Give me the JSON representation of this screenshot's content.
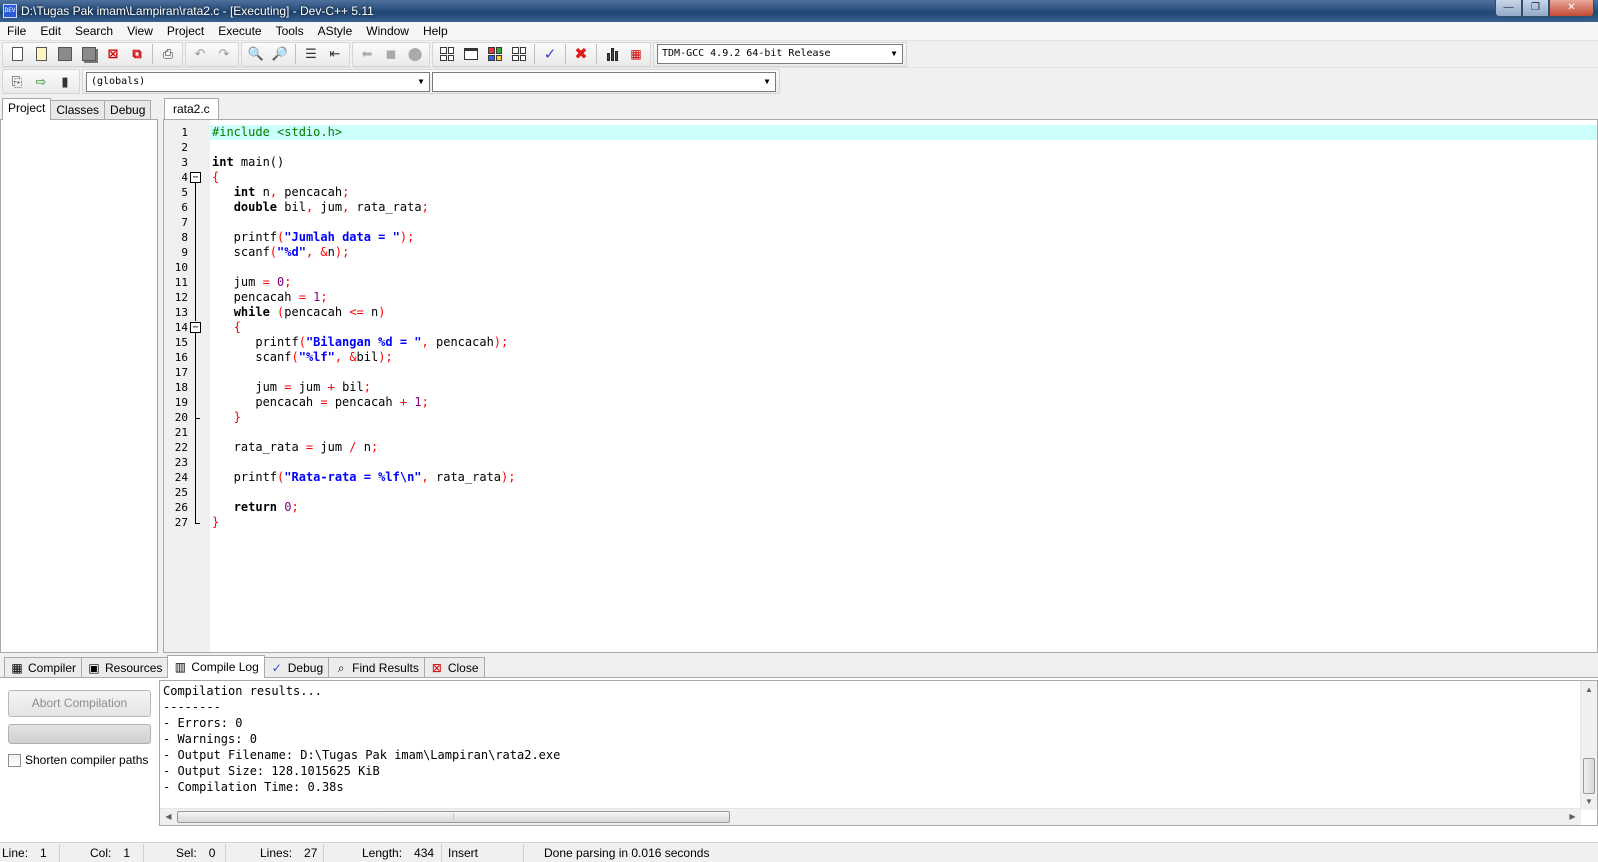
{
  "window": {
    "title": "D:\\Tugas Pak imam\\Lampiran\\rata2.c - [Executing] - Dev-C++ 5.11",
    "app_icon_text": "DEV"
  },
  "menu": [
    "File",
    "Edit",
    "Search",
    "View",
    "Project",
    "Execute",
    "Tools",
    "AStyle",
    "Window",
    "Help"
  ],
  "toolbar": {
    "compiler_select": "TDM-GCC 4.9.2 64-bit Release",
    "scope_select": "(globals)",
    "member_select": ""
  },
  "left_panel": {
    "tabs": [
      "Project",
      "Classes",
      "Debug"
    ],
    "active_tab": "Project"
  },
  "editor": {
    "tab": "rata2.c",
    "lines": [
      {
        "n": "1",
        "html": "<span class=\"pp\">#include &lt;stdio.h&gt;</span>",
        "current": true
      },
      {
        "n": "2",
        "html": ""
      },
      {
        "n": "3",
        "html": "<span class=\"kw\">int</span> main()"
      },
      {
        "n": "4",
        "html": "<span class=\"sym\">{</span>",
        "fold": "box"
      },
      {
        "n": "5",
        "html": "   <span class=\"kw\">int</span> n<span class=\"sym\">,</span> pencacah<span class=\"sym\">;</span>",
        "fold": "line"
      },
      {
        "n": "6",
        "html": "   <span class=\"kw\">double</span> bil<span class=\"sym\">,</span> jum<span class=\"sym\">,</span> rata_rata<span class=\"sym\">;</span>",
        "fold": "line"
      },
      {
        "n": "7",
        "html": "",
        "fold": "line"
      },
      {
        "n": "8",
        "html": "   printf<span class=\"sym\">(</span><span class=\"str\">\"Jumlah data = \"</span><span class=\"sym\">);</span>",
        "fold": "line"
      },
      {
        "n": "9",
        "html": "   scanf<span class=\"sym\">(</span><span class=\"str\">\"%d\"</span><span class=\"sym\">,</span> <span class=\"sym\">&amp;</span>n<span class=\"sym\">);</span>",
        "fold": "line"
      },
      {
        "n": "10",
        "html": "",
        "fold": "line"
      },
      {
        "n": "11",
        "html": "   jum <span class=\"sym\">=</span> <span class=\"num-lit\">0</span><span class=\"sym\">;</span>",
        "fold": "line"
      },
      {
        "n": "12",
        "html": "   pencacah <span class=\"sym\">=</span> <span class=\"num-lit\">1</span><span class=\"sym\">;</span>",
        "fold": "line"
      },
      {
        "n": "13",
        "html": "   <span class=\"kw\">while</span> <span class=\"sym\">(</span>pencacah <span class=\"sym\">&lt;=</span> n<span class=\"sym\">)</span>",
        "fold": "line"
      },
      {
        "n": "14",
        "html": "   <span class=\"sym\">{</span>",
        "fold": "box"
      },
      {
        "n": "15",
        "html": "      printf<span class=\"sym\">(</span><span class=\"str\">\"Bilangan %d = \"</span><span class=\"sym\">,</span> pencacah<span class=\"sym\">);</span>",
        "fold": "line"
      },
      {
        "n": "16",
        "html": "      scanf<span class=\"sym\">(</span><span class=\"str\">\"%lf\"</span><span class=\"sym\">,</span> <span class=\"sym\">&amp;</span>bil<span class=\"sym\">);</span>",
        "fold": "line"
      },
      {
        "n": "17",
        "html": "",
        "fold": "line"
      },
      {
        "n": "18",
        "html": "      jum <span class=\"sym\">=</span> jum <span class=\"sym\">+</span> bil<span class=\"sym\">;</span>",
        "fold": "line"
      },
      {
        "n": "19",
        "html": "      pencacah <span class=\"sym\">=</span> pencacah <span class=\"sym\">+</span> <span class=\"num-lit\">1</span><span class=\"sym\">;</span>",
        "fold": "line"
      },
      {
        "n": "20",
        "html": "   <span class=\"sym\">}</span>",
        "fold": "end-inner"
      },
      {
        "n": "21",
        "html": "",
        "fold": "line"
      },
      {
        "n": "22",
        "html": "   rata_rata <span class=\"sym\">=</span> jum <span class=\"sym\">/</span> n<span class=\"sym\">;</span>",
        "fold": "line"
      },
      {
        "n": "23",
        "html": "",
        "fold": "line"
      },
      {
        "n": "24",
        "html": "   printf<span class=\"sym\">(</span><span class=\"str\">\"Rata-rata = %lf\\n\"</span><span class=\"sym\">,</span> rata_rata<span class=\"sym\">);</span>",
        "fold": "line"
      },
      {
        "n": "25",
        "html": "",
        "fold": "line"
      },
      {
        "n": "26",
        "html": "   <span class=\"kw\">return</span> <span class=\"num-lit\">0</span><span class=\"sym\">;</span>",
        "fold": "line"
      },
      {
        "n": "27",
        "html": "<span class=\"sym\">}</span>",
        "fold": "end"
      }
    ]
  },
  "bottom_tabs": [
    {
      "label": "Compiler",
      "icon": "grid-icon"
    },
    {
      "label": "Resources",
      "icon": "resources-icon"
    },
    {
      "label": "Compile Log",
      "icon": "bar-chart-icon",
      "active": true
    },
    {
      "label": "Debug",
      "icon": "check-icon"
    },
    {
      "label": "Find Results",
      "icon": "find-icon"
    },
    {
      "label": "Close",
      "icon": "close-icon"
    }
  ],
  "bottom": {
    "abort_label": "Abort Compilation",
    "shorten_label": "Shorten compiler paths",
    "log": "Compilation results...\n--------\n- Errors: 0\n- Warnings: 0\n- Output Filename: D:\\Tugas Pak imam\\Lampiran\\rata2.exe\n- Output Size: 128.1015625 KiB\n- Compilation Time: 0.38s"
  },
  "status": {
    "line_label": "Line:",
    "line_value": "1",
    "col_label": "Col:",
    "col_value": "1",
    "sel_label": "Sel:",
    "sel_value": "0",
    "lines_label": "Lines:",
    "lines_value": "27",
    "length_label": "Length:",
    "length_value": "434",
    "mode": "Insert",
    "message": "Done parsing in 0.016 seconds"
  }
}
